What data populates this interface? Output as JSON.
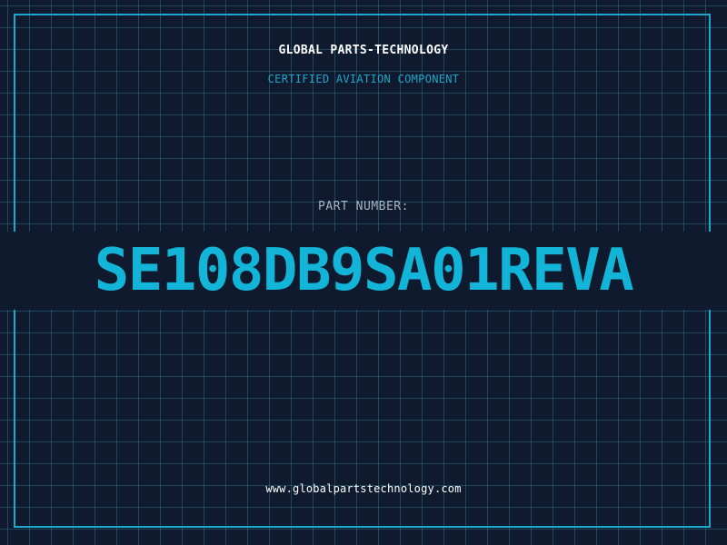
{
  "header": {
    "company": "GLOBAL PARTS-TECHNOLOGY",
    "subtitle": "CERTIFIED AVIATION COMPONENT"
  },
  "part": {
    "label": "PART NUMBER:",
    "number": "SE108DB9SA01REVA"
  },
  "footer": {
    "website": "www.globalpartstechnology.com"
  },
  "colors": {
    "background": "#0f1a2e",
    "accent": "#1ea6cc",
    "part_number": "#12b4d8",
    "grid": "#286e87"
  }
}
